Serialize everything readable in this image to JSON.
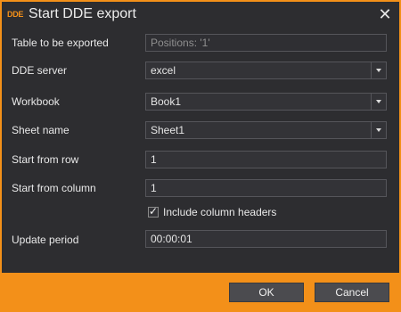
{
  "window": {
    "title": "Start DDE export",
    "icon_text": "DDE",
    "close_glyph": "✕"
  },
  "form": {
    "table": {
      "label": "Table to be exported",
      "value": "Positions: '1'"
    },
    "dde_server": {
      "label": "DDE server",
      "value": "excel"
    },
    "workbook": {
      "label": "Workbook",
      "value": "Book1"
    },
    "sheet_name": {
      "label": "Sheet name",
      "value": "Sheet1"
    },
    "start_row": {
      "label": "Start from row",
      "value": "1"
    },
    "start_column": {
      "label": "Start from column",
      "value": "1"
    },
    "include_headers": {
      "label": "Include column headers",
      "checked": true,
      "check_glyph": "✓"
    },
    "update_period": {
      "label": "Update period",
      "value": "00:00:01"
    }
  },
  "buttons": {
    "ok": "OK",
    "cancel": "Cancel"
  },
  "colors": {
    "accent": "#f39019",
    "background": "#2d2d30",
    "field": "#333337"
  }
}
